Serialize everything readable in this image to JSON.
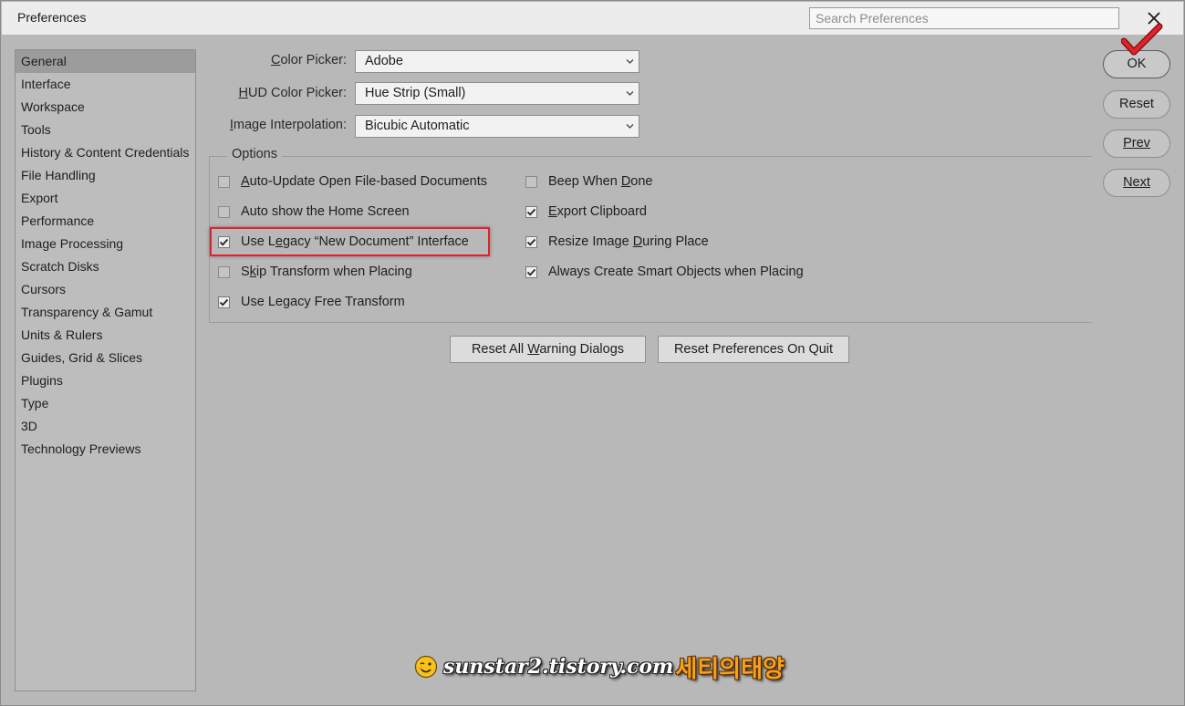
{
  "window": {
    "title": "Preferences",
    "search_placeholder": "Search Preferences"
  },
  "sidebar": {
    "items": [
      {
        "label": "General",
        "selected": true
      },
      {
        "label": "Interface"
      },
      {
        "label": "Workspace"
      },
      {
        "label": "Tools"
      },
      {
        "label": "History & Content Credentials"
      },
      {
        "label": "File Handling"
      },
      {
        "label": "Export"
      },
      {
        "label": "Performance"
      },
      {
        "label": "Image Processing"
      },
      {
        "label": "Scratch Disks"
      },
      {
        "label": "Cursors"
      },
      {
        "label": "Transparency & Gamut"
      },
      {
        "label": "Units & Rulers"
      },
      {
        "label": "Guides, Grid & Slices"
      },
      {
        "label": "Plugins"
      },
      {
        "label": "Type"
      },
      {
        "label": "3D"
      },
      {
        "label": "Technology Previews"
      }
    ]
  },
  "fields": {
    "color_picker": {
      "label_pre": "",
      "label_ul": "C",
      "label_post": "olor Picker:",
      "value": "Adobe"
    },
    "hud_color_picker": {
      "label_pre": "",
      "label_ul": "H",
      "label_post": "UD Color Picker:",
      "value": "Hue Strip (Small)"
    },
    "image_interpolation": {
      "label_pre": "",
      "label_ul": "I",
      "label_post": "mage Interpolation:",
      "value": "Bicubic Automatic"
    }
  },
  "options": {
    "title": "Options",
    "left": [
      {
        "label_pre": "",
        "label_ul": "A",
        "label_post": "uto-Update Open File-based Documents",
        "checked": false
      },
      {
        "label_pre": "Auto show the Home Screen",
        "label_ul": "",
        "label_post": "",
        "checked": false
      },
      {
        "label_pre": "Use L",
        "label_ul": "e",
        "label_post": "gacy “New Document” Interface",
        "checked": true
      },
      {
        "label_pre": "S",
        "label_ul": "k",
        "label_post": "ip Transform when Placing",
        "checked": false
      },
      {
        "label_pre": "Use Legacy Free Transform",
        "label_ul": "",
        "label_post": "",
        "checked": true
      }
    ],
    "right": [
      {
        "label_pre": "Beep When ",
        "label_ul": "D",
        "label_post": "one",
        "checked": false
      },
      {
        "label_pre": "",
        "label_ul": "E",
        "label_post": "xport Clipboard",
        "checked": true
      },
      {
        "label_pre": "Resize Image ",
        "label_ul": "D",
        "label_post": "uring Place",
        "checked": true
      },
      {
        "label_pre": "Always Create Smart Ob",
        "label_ul": "j",
        "label_post": "ects when Placing",
        "checked": true
      }
    ]
  },
  "buttons": {
    "reset_warnings": {
      "pre": "Reset All ",
      "ul": "W",
      "post": "arning Dialogs"
    },
    "reset_prefs": {
      "pre": "Reset Preferences On Quit",
      "ul": "",
      "post": ""
    },
    "ok": "OK",
    "reset": "Reset",
    "prev": "Prev",
    "next": "Next"
  },
  "watermark": {
    "site": "sunstar2.tistory.com",
    "korean": "세티의태양"
  },
  "colors": {
    "highlight": "#e0222a",
    "annotation_check": "#e0222a"
  }
}
